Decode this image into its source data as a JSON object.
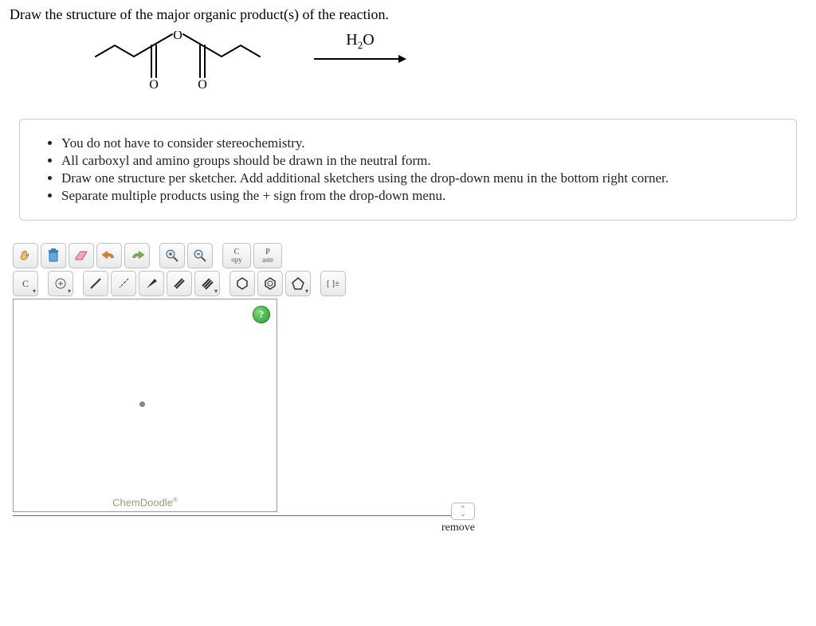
{
  "question": "Draw the structure of the major organic product(s) of the reaction.",
  "reagent": {
    "formula_html": "H₂O"
  },
  "hints": [
    "You do not have to consider stereochemistry.",
    "All carboxyl and amino groups should be drawn in the neutral form.",
    "Draw one structure per sketcher. Add additional sketchers using the drop-down menu in the bottom right corner.",
    "Separate multiple products using the + sign from the drop-down menu."
  ],
  "toolbar1": {
    "copy_top": "C",
    "copy_bot": "opy",
    "paste_top": "P",
    "paste_bot": "aste"
  },
  "toolbar2": {
    "element": "C",
    "charge": "[ ]±"
  },
  "canvas": {
    "help": "?",
    "brand": "ChemDoodle",
    "brand_sup": "®"
  },
  "controls": {
    "remove": "remove"
  }
}
